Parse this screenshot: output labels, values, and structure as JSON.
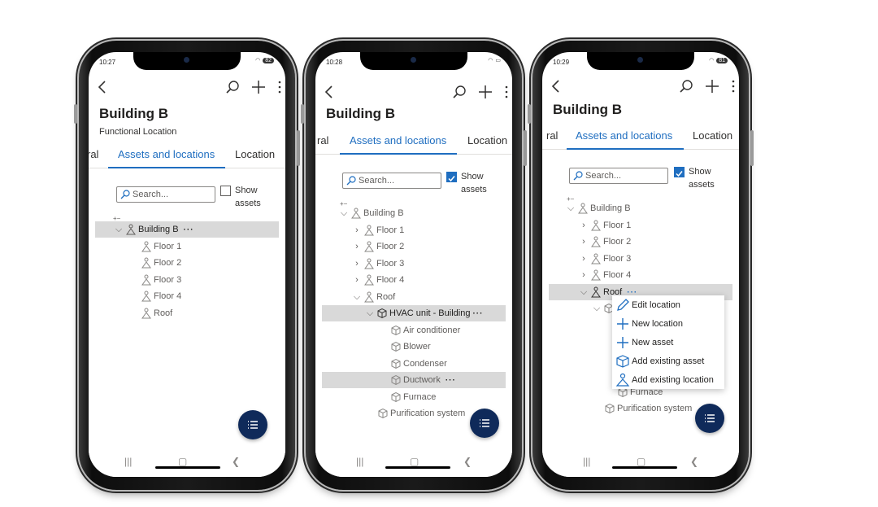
{
  "phones": [
    {
      "time": "10:27",
      "battery": "82",
      "title": "Building B",
      "subtitle": "Functional Location",
      "tabs": [
        "ral",
        "Assets and locations",
        "Location"
      ],
      "search_placeholder": "Search...",
      "show_assets_label": "Show assets",
      "show_assets_checked": false,
      "expand_controls": "+−",
      "tree": [
        {
          "label": "Building B",
          "chevron": "down",
          "type": "location",
          "selected": true,
          "more": "···"
        },
        {
          "label": "Floor 1",
          "type": "location"
        },
        {
          "label": "Floor 2",
          "type": "location"
        },
        {
          "label": "Floor 3",
          "type": "location"
        },
        {
          "label": "Floor 4",
          "type": "location"
        },
        {
          "label": "Roof",
          "type": "location"
        }
      ]
    },
    {
      "time": "10:28",
      "battery": "",
      "title": "Building B",
      "tabs": [
        "ral",
        "Assets and locations",
        "Location"
      ],
      "search_placeholder": "Search...",
      "show_assets_label": "Show assets",
      "show_assets_checked": true,
      "expand_controls": "+−",
      "tree": [
        {
          "label": "Building B",
          "chevron": "down",
          "type": "location"
        },
        {
          "label": "Floor 1",
          "chevron": "right",
          "type": "location"
        },
        {
          "label": "Floor 2",
          "chevron": "right",
          "type": "location"
        },
        {
          "label": "Floor 3",
          "chevron": "right",
          "type": "location"
        },
        {
          "label": "Floor 4",
          "chevron": "right",
          "type": "location"
        },
        {
          "label": "Roof",
          "chevron": "down",
          "type": "location"
        },
        {
          "label": "HVAC unit - Building",
          "chevron": "down",
          "type": "asset",
          "selected": true,
          "more": "···"
        },
        {
          "label": "Air conditioner",
          "type": "asset"
        },
        {
          "label": "Blower",
          "type": "asset"
        },
        {
          "label": "Condenser",
          "type": "asset"
        },
        {
          "label": "Ductwork",
          "type": "asset",
          "selected": true,
          "more": "···"
        },
        {
          "label": "Furnace",
          "type": "asset"
        },
        {
          "label": "Purification system",
          "type": "asset"
        }
      ]
    },
    {
      "time": "10:29",
      "battery": "81",
      "title": "Building B",
      "tabs": [
        "ral",
        "Assets and locations",
        "Location"
      ],
      "search_placeholder": "Search...",
      "show_assets_label": "Show assets",
      "show_assets_checked": true,
      "expand_controls": "+−",
      "tree": [
        {
          "label": "Building B",
          "chevron": "down",
          "type": "location"
        },
        {
          "label": "Floor 1",
          "chevron": "right",
          "type": "location"
        },
        {
          "label": "Floor 2",
          "chevron": "right",
          "type": "location"
        },
        {
          "label": "Floor 3",
          "chevron": "right",
          "type": "location"
        },
        {
          "label": "Floor 4",
          "chevron": "right",
          "type": "location"
        },
        {
          "label": "Roof",
          "chevron": "down",
          "type": "location",
          "selected": true,
          "more": "···"
        },
        {
          "label": "",
          "chevron": "down",
          "type": "asset"
        },
        {
          "label": "",
          "type": "asset"
        },
        {
          "label": "",
          "type": "asset"
        },
        {
          "label": "",
          "type": "asset"
        },
        {
          "label": "",
          "type": "asset"
        },
        {
          "label": "Furnace",
          "type": "asset"
        },
        {
          "label": "Purification system",
          "type": "asset"
        }
      ],
      "context_menu": [
        {
          "label": "Edit location",
          "icon": "pencil-icon"
        },
        {
          "label": "New location",
          "icon": "plus-icon"
        },
        {
          "label": "New asset",
          "icon": "plus-icon"
        },
        {
          "label": "Add existing asset",
          "icon": "box-icon"
        },
        {
          "label": "Add existing location",
          "icon": "location-person-icon"
        }
      ]
    }
  ],
  "colors": {
    "accent": "#1f6ec0",
    "selected_row": "#d9d9d9",
    "fab": "#0f2a5a"
  }
}
